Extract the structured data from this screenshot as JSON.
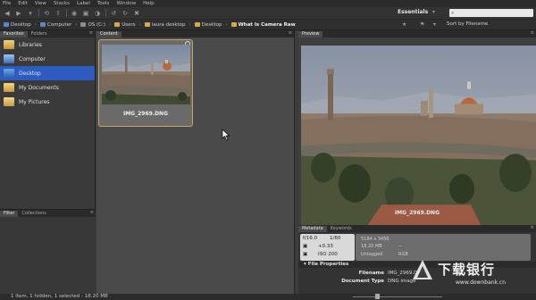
{
  "menu": [
    "File",
    "Edit",
    "View",
    "Stacks",
    "Label",
    "Tools",
    "Window",
    "Help"
  ],
  "toolbar": {
    "workspace": "Essentials",
    "search_placeholder": ""
  },
  "path": [
    {
      "label": "Desktop",
      "kind": "pc"
    },
    {
      "label": "Computer",
      "kind": "pc"
    },
    {
      "label": "OS (C:)",
      "kind": "drv"
    },
    {
      "label": "Users",
      "kind": "folder"
    },
    {
      "label": "laura desktop",
      "kind": "folder"
    },
    {
      "label": "Desktop",
      "kind": "folder"
    },
    {
      "label": "What Is Camera Raw",
      "kind": "folder"
    }
  ],
  "sort_label": "Sort by Filename",
  "left": {
    "tabs": [
      "Favorites",
      "Folders"
    ],
    "items": [
      {
        "label": "Libraries",
        "icon": "libraries-icon"
      },
      {
        "label": "Computer",
        "icon": "computer-icon"
      },
      {
        "label": "Desktop",
        "icon": "desktop-icon"
      },
      {
        "label": "My Documents",
        "icon": "documents-icon"
      },
      {
        "label": "My Pictures",
        "icon": "pictures-icon"
      }
    ],
    "filter_tabs": [
      "Filter",
      "Collections"
    ]
  },
  "content": {
    "tab": "Content",
    "thumb_name": "IMG_2969.DNG"
  },
  "preview": {
    "tab": "Preview",
    "name": "IMG_2969.DNG"
  },
  "metadata": {
    "tabs": [
      "Metadata",
      "Keywords"
    ],
    "aperture": "f/16.0",
    "shutter": "1/60",
    "exposure": "+0.33",
    "iso": "ISO 200",
    "dimensions": "5184 x 3456",
    "dash1": "--",
    "size": "18.20 MB",
    "dash2": "--",
    "tagged": "Untagged",
    "mode": "RGB",
    "file_properties": "File Properties",
    "rows": [
      {
        "key": "Filename",
        "value": "IMG_2969.DNG"
      },
      {
        "key": "Document Type",
        "value": "DNG image"
      }
    ]
  },
  "status": "1 item, 1 hidden, 1 selected - 18.20 MB",
  "watermark": {
    "text": "下载银行",
    "url": "www.downbank.cn"
  },
  "colors": {
    "selection": "#2e5bbf",
    "thumb_border": "#c9a45a",
    "panel": "#3a3a3a"
  }
}
